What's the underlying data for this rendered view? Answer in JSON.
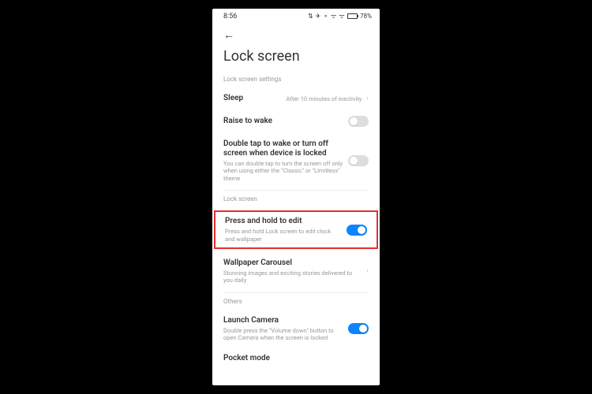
{
  "status": {
    "time": "8:56",
    "battery_pct": "78%",
    "icons": "⇅ ✈ ⚬ ᯤ ᯤ"
  },
  "header": {
    "title": "Lock screen"
  },
  "sections": {
    "lock_screen_settings": {
      "label": "Lock screen settings",
      "sleep": {
        "title": "Sleep",
        "value": "After 10 minutes of inactivity"
      },
      "raise_to_wake": {
        "title": "Raise to wake",
        "on": false
      },
      "double_tap": {
        "title": "Double tap to wake or turn off screen when device is locked",
        "sub": "You can double tap to turn the screen off only when using either the \"Classic\" or \"Limitless\" theme",
        "on": false
      }
    },
    "lock_screen": {
      "label": "Lock screen",
      "press_hold": {
        "title": "Press and hold to edit",
        "sub": "Press and hold Lock screen to edit clock and wallpaper",
        "on": true
      },
      "wallpaper_carousel": {
        "title": "Wallpaper Carousel",
        "sub": "Stunning images and exciting stories delivered to you daily"
      }
    },
    "others": {
      "label": "Others",
      "launch_camera": {
        "title": "Launch Camera",
        "sub": "Double press the \"Volume down\" button to open Camera when the screen is locked",
        "on": true
      },
      "pocket_mode": {
        "title": "Pocket mode"
      }
    }
  },
  "colors": {
    "accent": "#0a84ff",
    "highlight_border": "#e03030"
  }
}
